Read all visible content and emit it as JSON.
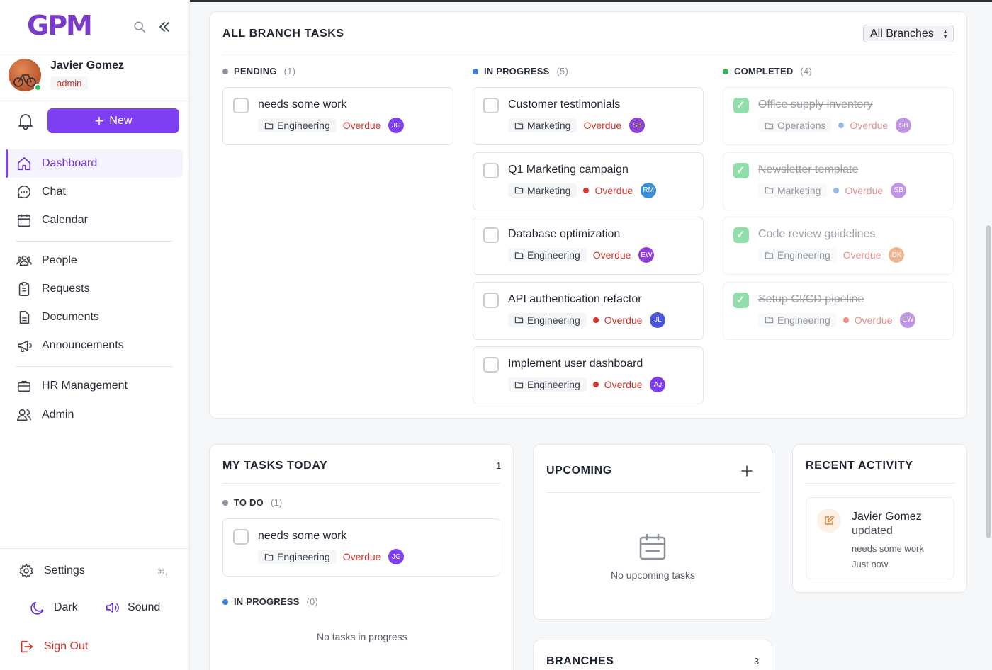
{
  "app": {
    "logo": "GPM"
  },
  "user": {
    "name": "Javier Gomez",
    "role": "admin"
  },
  "sidebar": {
    "new_label": "New",
    "items": [
      {
        "label": "Dashboard"
      },
      {
        "label": "Chat"
      },
      {
        "label": "Calendar"
      },
      {
        "label": "People"
      },
      {
        "label": "Requests"
      },
      {
        "label": "Documents"
      },
      {
        "label": "Announcements"
      },
      {
        "label": "HR Management"
      },
      {
        "label": "Admin"
      }
    ],
    "settings_label": "Settings",
    "settings_shortcut": "⌘,",
    "theme_label": "Dark",
    "sound_label": "Sound",
    "signout_label": "Sign Out"
  },
  "branch_tasks": {
    "title": "ALL BRANCH TASKS",
    "branch_filter": "All Branches",
    "columns": [
      {
        "label": "PENDING",
        "count": "(1)",
        "color": "#8b909a"
      },
      {
        "label": "IN PROGRESS",
        "count": "(5)",
        "color": "#3d7be0"
      },
      {
        "label": "COMPLETED",
        "count": "(4)",
        "color": "#36b45a"
      }
    ],
    "pending": [
      {
        "title": "needs some work",
        "dept": "Engineering",
        "status": "Overdue",
        "initials": "JG",
        "avatar_color": "#7e3ff2"
      }
    ],
    "in_progress": [
      {
        "title": "Customer testimonials",
        "dept": "Marketing",
        "status": "Overdue",
        "initials": "SB",
        "avatar_color": "#8e3fd6"
      },
      {
        "title": "Q1 Marketing campaign",
        "dept": "Marketing",
        "status": "Overdue",
        "initials": "RM",
        "avatar_color": "#3b8fd6"
      },
      {
        "title": "Database optimization",
        "dept": "Engineering",
        "status": "Overdue",
        "initials": "EW",
        "avatar_color": "#8e3fd6"
      },
      {
        "title": "API authentication refactor",
        "dept": "Engineering",
        "status": "Overdue",
        "initials": "JL",
        "avatar_color": "#4a55d6"
      },
      {
        "title": "Implement user dashboard",
        "dept": "Engineering",
        "status": "Overdue",
        "initials": "AJ",
        "avatar_color": "#7e3ff2"
      }
    ],
    "completed": [
      {
        "title": "Office supply inventory",
        "dept": "Operations",
        "status": "Overdue",
        "initials": "SB",
        "avatar_color": "#8e3fd6"
      },
      {
        "title": "Newsletter template",
        "dept": "Marketing",
        "status": "Overdue",
        "initials": "SB",
        "avatar_color": "#8e3fd6"
      },
      {
        "title": "Code review guidelines",
        "dept": "Engineering",
        "status": "Overdue",
        "initials": "DK",
        "avatar_color": "#e07a3a"
      },
      {
        "title": "Setup CI/CD pipeline",
        "dept": "Engineering",
        "status": "Overdue",
        "initials": "EW",
        "avatar_color": "#8e3fd6"
      }
    ]
  },
  "my_tasks": {
    "title": "MY TASKS TODAY",
    "count": "1",
    "todo_label": "TO DO",
    "todo_count": "(1)",
    "todo_task": {
      "title": "needs some work",
      "dept": "Engineering",
      "status": "Overdue",
      "initials": "JG",
      "avatar_color": "#7e3ff2"
    },
    "inprogress_label": "IN PROGRESS",
    "inprogress_count": "(0)",
    "empty_text": "No tasks in progress"
  },
  "upcoming": {
    "title": "UPCOMING",
    "empty_text": "No upcoming tasks"
  },
  "branches": {
    "title": "BRANCHES",
    "count": "3"
  },
  "activity": {
    "title": "RECENT ACTIVITY",
    "items": [
      {
        "name": "Javier Gomez",
        "verb": "updated",
        "object": "needs some work",
        "time": "Just now"
      }
    ]
  }
}
